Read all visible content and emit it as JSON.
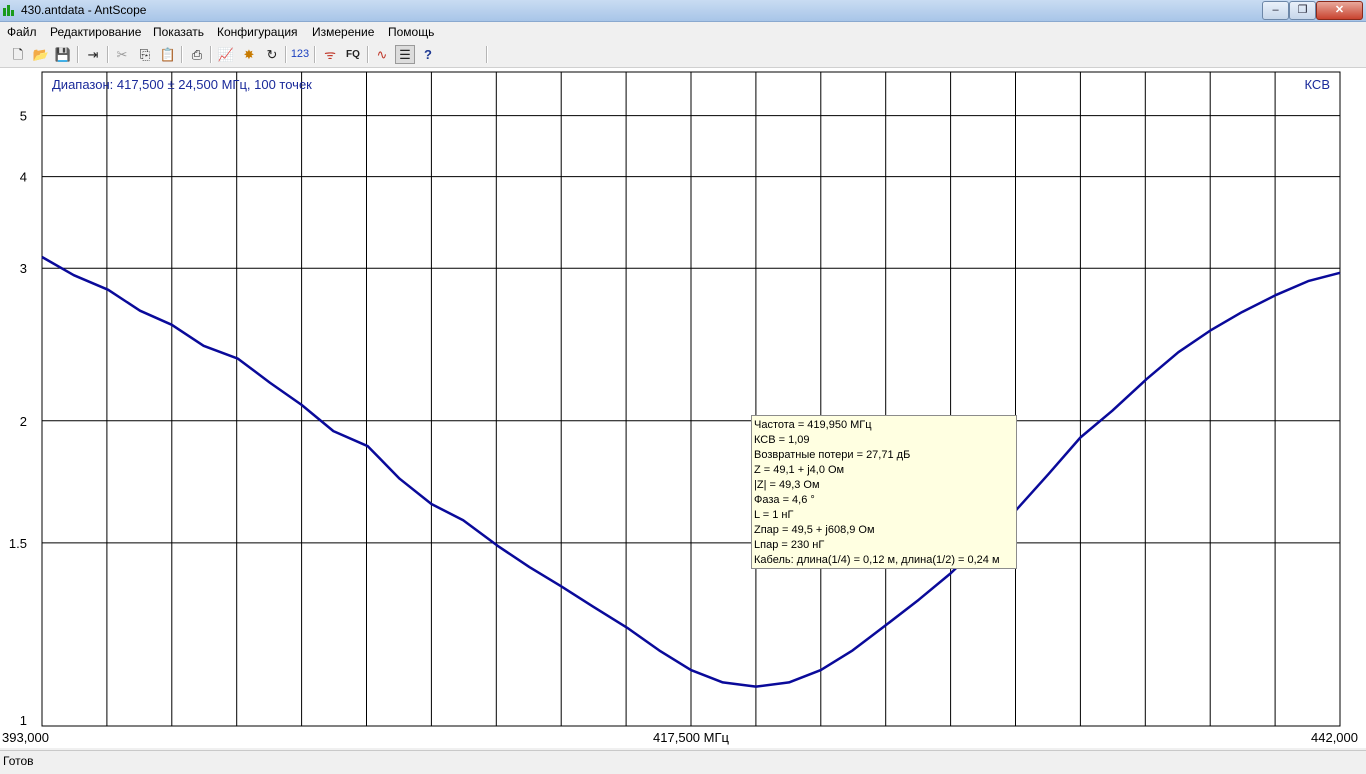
{
  "window": {
    "title": "430.antdata - AntScope",
    "minimize": "–",
    "maximize": "❐",
    "close": "✕"
  },
  "menu": [
    "Файл",
    "Редактирование",
    "Показать",
    "Конфигурация",
    "Измерение",
    "Помощь"
  ],
  "toolbar": {
    "buttons": [
      {
        "name": "new-file-icon",
        "glyph": "🗋"
      },
      {
        "name": "open-folder-icon",
        "glyph": "📂"
      },
      {
        "name": "save-icon",
        "glyph": "💾"
      },
      {
        "name": "export-icon",
        "glyph": "⇥"
      },
      {
        "name": "cut-icon",
        "glyph": "✂"
      },
      {
        "name": "copy-icon",
        "glyph": "⎘"
      },
      {
        "name": "paste-icon",
        "glyph": "📋"
      },
      {
        "name": "print-icon",
        "glyph": "⎙"
      },
      {
        "name": "chart-icon",
        "glyph": "📈"
      },
      {
        "name": "star-icon",
        "glyph": "✸"
      },
      {
        "name": "refresh-icon",
        "glyph": "↻"
      },
      {
        "name": "numeric-icon",
        "glyph": "123"
      },
      {
        "name": "antenna-icon",
        "glyph": "ᯤ"
      },
      {
        "name": "fq-icon",
        "glyph": "FQ"
      },
      {
        "name": "curve-icon",
        "glyph": "∿"
      },
      {
        "name": "list-icon",
        "glyph": "☰"
      },
      {
        "name": "help-icon",
        "glyph": "?"
      }
    ]
  },
  "chart_data": {
    "type": "line",
    "title": "Диапазон: 417,500 ± 24,500 МГц, 100 точек",
    "ylabel": "КСВ",
    "xlabel": "417,500 МГц",
    "xlim": [
      393.0,
      442.0
    ],
    "ylim": [
      1,
      6
    ],
    "y_scale": "swr",
    "x_tick_labels": [
      "393,000",
      "442,000"
    ],
    "y_ticks": [
      1,
      1.5,
      2,
      3,
      4,
      5
    ],
    "grid": true,
    "series": [
      {
        "color": "#0a0a9a",
        "x": [
          393.0,
          394.2,
          395.5,
          396.7,
          397.9,
          399.1,
          400.4,
          401.6,
          402.8,
          404.0,
          405.3,
          406.5,
          407.7,
          408.9,
          410.2,
          411.4,
          412.6,
          413.8,
          415.1,
          416.3,
          417.5,
          418.7,
          419.95,
          421.2,
          422.4,
          423.6,
          424.9,
          426.1,
          427.3,
          428.5,
          429.8,
          431.0,
          432.2,
          433.4,
          434.7,
          435.9,
          437.1,
          438.3,
          439.6,
          440.8,
          442.0
        ],
        "y": [
          3.1,
          2.94,
          2.82,
          2.66,
          2.56,
          2.42,
          2.34,
          2.2,
          2.08,
          1.95,
          1.88,
          1.74,
          1.64,
          1.58,
          1.49,
          1.42,
          1.36,
          1.3,
          1.24,
          1.18,
          1.13,
          1.1,
          1.09,
          1.1,
          1.13,
          1.18,
          1.25,
          1.32,
          1.4,
          1.5,
          1.62,
          1.76,
          1.92,
          2.05,
          2.22,
          2.38,
          2.52,
          2.65,
          2.78,
          2.89,
          2.96
        ]
      }
    ]
  },
  "tooltip": {
    "lines": [
      "Частота = 419,950 МГц",
      "КСВ = 1,09",
      "Возвратные потери = 27,71 дБ",
      "Z = 49,1 + j4,0 Ом",
      "|Z| = 49,3 Ом",
      "Фаза = 4,6 °",
      "L = 1 нГ",
      "Zпар = 49,5 + j608,9 Ом",
      "Lпар = 230 нГ",
      "Кабель: длина(1/4) = 0,12 м, длина(1/2) = 0,24 м"
    ]
  },
  "status": "Готов"
}
